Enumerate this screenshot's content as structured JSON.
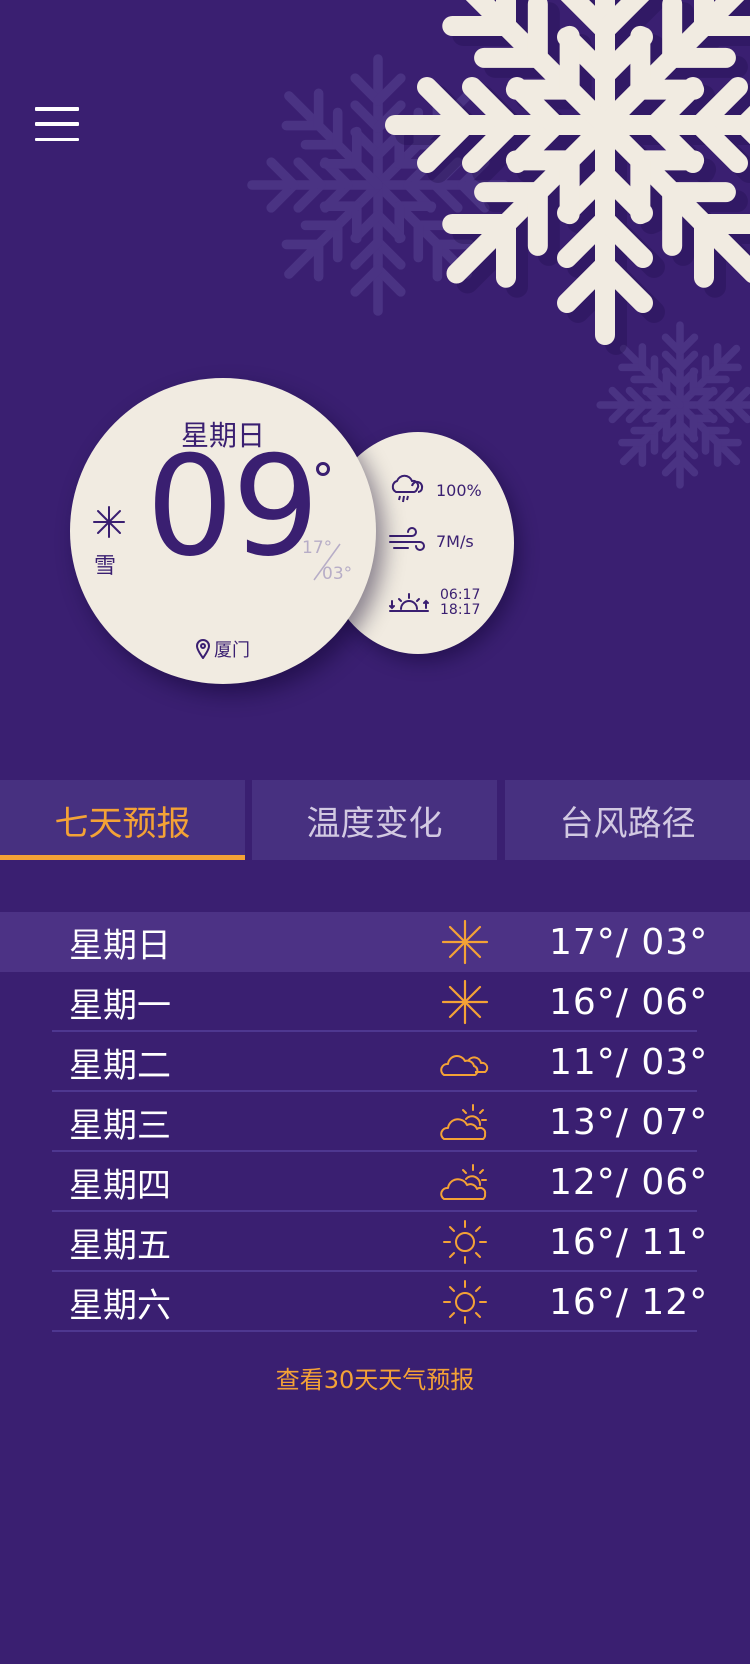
{
  "current": {
    "day": "星期日",
    "temp": "09",
    "condition": "雪",
    "high": "17°",
    "low": "03°",
    "location": "厦门",
    "humidity": "100%",
    "wind": "7M/s",
    "sunrise": "06:17",
    "sunset": "18:17"
  },
  "tabs": [
    {
      "label": "七天预报",
      "active": true
    },
    {
      "label": "温度变化",
      "active": false
    },
    {
      "label": "台风路径",
      "active": false
    }
  ],
  "forecast": [
    {
      "day": "星期日",
      "icon": "snow-icon",
      "temps": "17°/ 03°"
    },
    {
      "day": "星期一",
      "icon": "snow-icon",
      "temps": "16°/ 06°"
    },
    {
      "day": "星期二",
      "icon": "cloud-icon",
      "temps": "11°/ 03°"
    },
    {
      "day": "星期三",
      "icon": "partly-sunny-icon",
      "temps": "13°/ 07°"
    },
    {
      "day": "星期四",
      "icon": "partly-sunny-icon",
      "temps": "12°/ 06°"
    },
    {
      "day": "星期五",
      "icon": "sun-icon",
      "temps": "16°/ 11°"
    },
    {
      "day": "星期六",
      "icon": "sun-icon",
      "temps": "16°/ 12°"
    }
  ],
  "more_link": "查看30天天气预报",
  "colors": {
    "background": "#3a1f71",
    "accent": "#f4a236",
    "card": "#f1ebe1",
    "tab_bg": "#473080"
  }
}
